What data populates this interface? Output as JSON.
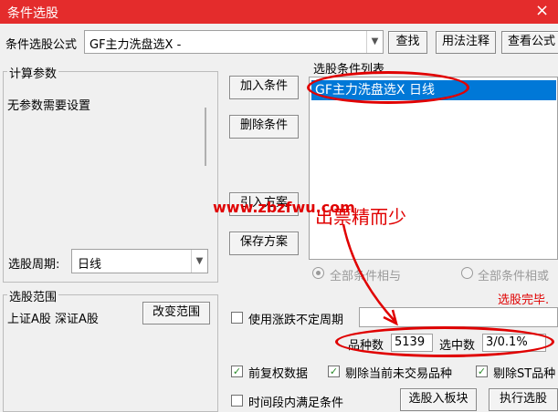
{
  "window": {
    "title": "条件选股",
    "close_glyph": "×"
  },
  "formula": {
    "label": "条件选股公式",
    "value": "GF主力洗盘选X  -",
    "find_button": "查找",
    "usage_button": "用法注释",
    "view_button": "查看公式"
  },
  "params": {
    "legend": "计算参数",
    "empty_text": "无参数需要设置",
    "period_label": "选股周期:",
    "period_value": "日线"
  },
  "actions": {
    "add_condition": "加入条件",
    "delete_condition": "删除条件",
    "import_plan": "引入方案",
    "save_plan": "保存方案"
  },
  "condition_list": {
    "legend": "选股条件列表",
    "items": [
      "GF主力洗盘选X  日线"
    ]
  },
  "logic": {
    "all_and": "全部条件相与",
    "all_or": "全部条件相或"
  },
  "status": {
    "done_text": "选股完毕."
  },
  "scope": {
    "legend": "选股范围",
    "text": "上证A股 深证A股",
    "change_button": "改变范围"
  },
  "options": {
    "volatile_period_label": "使用涨跌不定周期",
    "count_label": "品种数",
    "count_value": "5139",
    "selected_label": "选中数",
    "selected_value": "3/0.1%",
    "forward_adjust_label": "前复权数据",
    "exclude_untraded_label": "剔除当前未交易品种",
    "exclude_st_label": "剔除ST品种",
    "time_range_label": "时间段内满足条件",
    "add_to_block_button": "选股入板块",
    "execute_button": "执行选股"
  },
  "annotations": {
    "watermark": "www.zbzfwu.com",
    "callout": "出票精而少"
  },
  "colors": {
    "titlebar": "#e42c2c",
    "selection": "#0078d7",
    "annotation": "#e00000",
    "status_red": "#e00000",
    "check_green": "#2a8a2a"
  }
}
